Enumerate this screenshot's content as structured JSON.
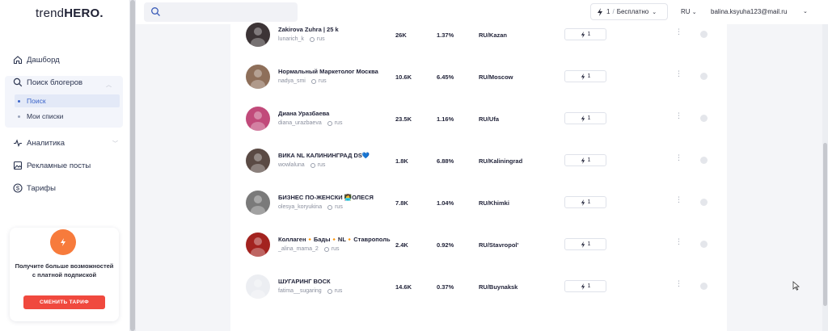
{
  "app": {
    "logo_light": "trend",
    "logo_bold": "HERO."
  },
  "header": {
    "search_placeholder": "",
    "plan_count": "1",
    "plan_sep": "/",
    "plan_name": "Бесплатно",
    "language": "RU",
    "user_email": "balina.ksyuha123@mail.ru"
  },
  "sidebar": {
    "dashboard": "Дашборд",
    "search_bloggers": "Поиск блогеров",
    "sub_search": "Поиск",
    "sub_lists": "Мои списки",
    "analytics": "Аналитика",
    "ad_posts": "Рекламные посты",
    "tariffs": "Тарифы"
  },
  "promo": {
    "text": "Получите больше возможностей с платной подпиской",
    "button": "СМЕНИТЬ ТАРИФ"
  },
  "rows": [
    {
      "name": "Zakirova Zuhra | 25 k",
      "handle": "lunarich_k",
      "lang": "rus",
      "followers": "26K",
      "er": "1.37%",
      "geo": "RU/Kazan",
      "cost": "1",
      "avatar_color": "#3c3436"
    },
    {
      "name": "Нормальный Маркетолог Москва",
      "handle": "nadya_smi",
      "lang": "rus",
      "followers": "10.6K",
      "er": "6.45%",
      "geo": "RU/Moscow",
      "cost": "1",
      "avatar_color": "#8e6f5a"
    },
    {
      "name": "Диана Уразбаева",
      "handle": "diana_urazbaeva",
      "lang": "rus",
      "followers": "23.5K",
      "er": "1.16%",
      "geo": "RU/Ufa",
      "cost": "1",
      "avatar_color": "#c14a7a"
    },
    {
      "name": "ВИКА NL КАЛИНИНГРАД DS💙",
      "handle": "wowlaluna",
      "lang": "rus",
      "followers": "1.8K",
      "er": "6.88%",
      "geo": "RU/Kaliningrad",
      "cost": "1",
      "avatar_color": "#5a4a44"
    },
    {
      "name": "БИЗНЕС ПО-ЖЕНСКИ 👩‍💻ОЛЕСЯ",
      "handle": "olesya_koryukina",
      "lang": "rus",
      "followers": "7.8K",
      "er": "1.04%",
      "geo": "RU/Khimki",
      "cost": "1",
      "avatar_color": "#7a7a7a"
    },
    {
      "name": "Коллаген🔸Бады🔸NL🔸Ставрополь",
      "handle": "_alina_mama_2",
      "lang": "rus",
      "followers": "2.4K",
      "er": "0.92%",
      "geo": "RU/Stavropol'",
      "cost": "1",
      "avatar_color": "#a3231f"
    },
    {
      "name": "ШУГАРИНГ ВОСК",
      "handle": "fatima__sugaring",
      "lang": "rus",
      "followers": "14.6K",
      "er": "0.37%",
      "geo": "RU/Buynaksk",
      "cost": "1",
      "avatar_color": "#eceef2"
    }
  ],
  "colors": {
    "accent_blue": "#3a63c9",
    "promo_orange": "#f77b3c",
    "promo_button": "#f0493e"
  }
}
